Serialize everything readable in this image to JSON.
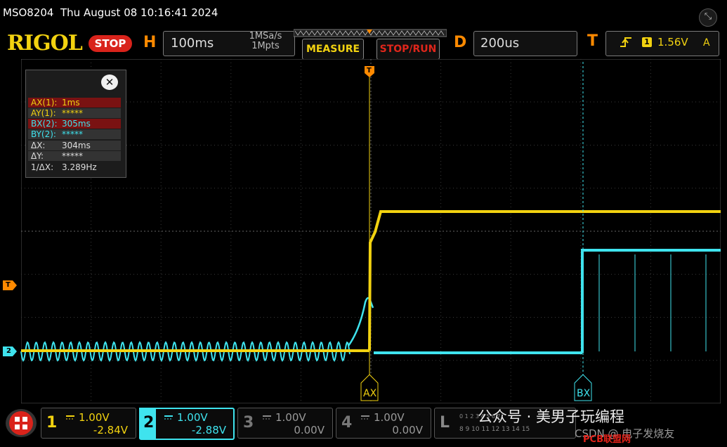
{
  "status": {
    "model": "MSO8204",
    "datetime": "Thu August 08 10:16:41 2024"
  },
  "header": {
    "brand": "RIGOL",
    "run_state": "STOP",
    "horizontal": {
      "letter": "H",
      "timebase": "100ms",
      "sample_rate": "1MSa/s",
      "memory_depth": "1Mpts"
    },
    "measure_label": "MEASURE",
    "stoprun_label": "STOP/RUN",
    "delay": {
      "letter": "D",
      "value": "200us"
    },
    "trigger": {
      "letter": "T",
      "source": "1",
      "level": "1.56V",
      "mode": "A"
    }
  },
  "cursor_panel": {
    "rows": [
      {
        "key": "AX(1):",
        "value": "1ms"
      },
      {
        "key": "AY(1):",
        "value": "*****"
      },
      {
        "key": "BX(2):",
        "value": "305ms"
      },
      {
        "key": "BY(2):",
        "value": "*****"
      },
      {
        "key": "ΔX:",
        "value": "304ms"
      },
      {
        "key": "ΔY:",
        "value": "*****"
      },
      {
        "key": "1/ΔX:",
        "value": "3.289Hz"
      }
    ]
  },
  "markers": {
    "cursor_a": "AX",
    "cursor_b": "BX",
    "trigger_tag": "T",
    "ch1_tag": "T",
    "ch2_tag": "2"
  },
  "channels": [
    {
      "num": "1",
      "scale": "1.00V",
      "offset": "-2.84V",
      "color": "#f2d210",
      "active": false
    },
    {
      "num": "2",
      "scale": "1.00V",
      "offset": "-2.88V",
      "color": "#3fe3ee",
      "active": true
    },
    {
      "num": "3",
      "scale": "1.00V",
      "offset": "0.00V",
      "color": "#777777",
      "active": false
    },
    {
      "num": "4",
      "scale": "1.00V",
      "offset": "0.00V",
      "color": "#777777",
      "active": false
    }
  ],
  "logic": {
    "letter": "L",
    "row1": "0 1 2 3 4 5 6 7",
    "row2": "8 9 10 11 12 13 14 15"
  },
  "overlay": {
    "text": "公众号 · 美男子玩编程",
    "sub": "CSDN @ 电子发烧友",
    "site": "PCB联盟网"
  },
  "colors": {
    "ch1": "#f2d210",
    "ch2": "#3fe3ee",
    "accent": "#ff8a00",
    "stop": "#d9231b"
  }
}
